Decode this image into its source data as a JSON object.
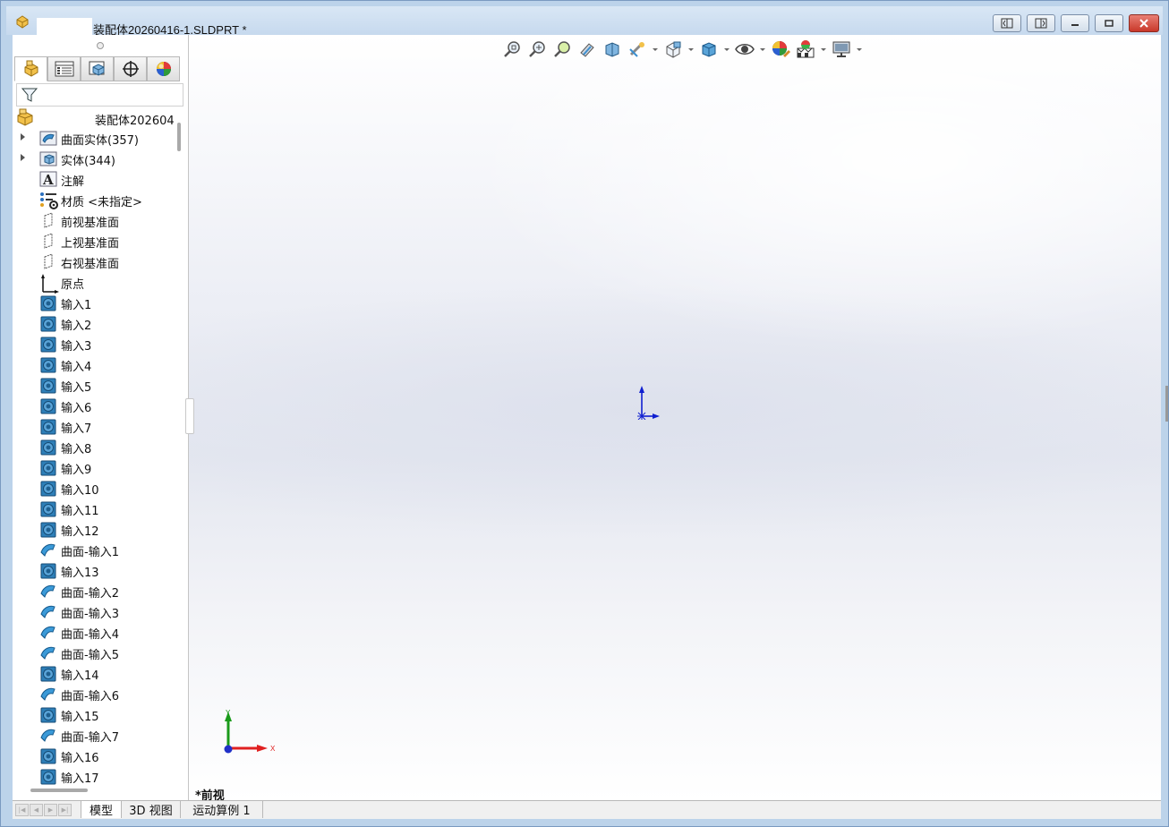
{
  "window": {
    "title": "装配体20260416-1.SLDPRT *",
    "buttons": [
      "tile-left",
      "tile-right",
      "minimize",
      "restore",
      "close"
    ]
  },
  "panel": {
    "tabs": [
      {
        "name": "featuremanager",
        "icon": "assembly-tree-icon"
      },
      {
        "name": "propertymanager",
        "icon": "property-list-icon"
      },
      {
        "name": "configurationmanager",
        "icon": "configuration-icon"
      },
      {
        "name": "dimxpert",
        "icon": "crosshair-icon"
      },
      {
        "name": "display-manager",
        "icon": "appearance-ball-icon"
      }
    ],
    "root_label": "装配体202604",
    "tree": [
      {
        "label": "曲面实体(357)",
        "icon": "surface-bodies-folder-icon",
        "expandable": true
      },
      {
        "label": "实体(344)",
        "icon": "solid-bodies-folder-icon",
        "expandable": true
      },
      {
        "label": "注解",
        "icon": "annotations-icon",
        "expandable": false
      },
      {
        "label": "材质 <未指定>",
        "icon": "material-icon",
        "expandable": false
      },
      {
        "label": "前视基准面",
        "icon": "plane-icon",
        "expandable": false
      },
      {
        "label": "上视基准面",
        "icon": "plane-icon",
        "expandable": false
      },
      {
        "label": "右视基准面",
        "icon": "plane-icon",
        "expandable": false
      },
      {
        "label": "原点",
        "icon": "origin-icon",
        "expandable": false
      },
      {
        "label": "输入1",
        "icon": "imported-body-icon",
        "expandable": false
      },
      {
        "label": "输入2",
        "icon": "imported-body-icon",
        "expandable": false
      },
      {
        "label": "输入3",
        "icon": "imported-body-icon",
        "expandable": false
      },
      {
        "label": "输入4",
        "icon": "imported-body-icon",
        "expandable": false
      },
      {
        "label": "输入5",
        "icon": "imported-body-icon",
        "expandable": false
      },
      {
        "label": "输入6",
        "icon": "imported-body-icon",
        "expandable": false
      },
      {
        "label": "输入7",
        "icon": "imported-body-icon",
        "expandable": false
      },
      {
        "label": "输入8",
        "icon": "imported-body-icon",
        "expandable": false
      },
      {
        "label": "输入9",
        "icon": "imported-body-icon",
        "expandable": false
      },
      {
        "label": "输入10",
        "icon": "imported-body-icon",
        "expandable": false
      },
      {
        "label": "输入11",
        "icon": "imported-body-icon",
        "expandable": false
      },
      {
        "label": "输入12",
        "icon": "imported-body-icon",
        "expandable": false
      },
      {
        "label": "曲面-输入1",
        "icon": "imported-surface-icon",
        "expandable": false
      },
      {
        "label": "输入13",
        "icon": "imported-body-icon",
        "expandable": false
      },
      {
        "label": "曲面-输入2",
        "icon": "imported-surface-icon",
        "expandable": false
      },
      {
        "label": "曲面-输入3",
        "icon": "imported-surface-icon",
        "expandable": false
      },
      {
        "label": "曲面-输入4",
        "icon": "imported-surface-icon",
        "expandable": false
      },
      {
        "label": "曲面-输入5",
        "icon": "imported-surface-icon",
        "expandable": false
      },
      {
        "label": "输入14",
        "icon": "imported-body-icon",
        "expandable": false
      },
      {
        "label": "曲面-输入6",
        "icon": "imported-surface-icon",
        "expandable": false
      },
      {
        "label": "输入15",
        "icon": "imported-body-icon",
        "expandable": false
      },
      {
        "label": "曲面-输入7",
        "icon": "imported-surface-icon",
        "expandable": false
      },
      {
        "label": "输入16",
        "icon": "imported-body-icon",
        "expandable": false
      },
      {
        "label": "输入17",
        "icon": "imported-body-icon",
        "expandable": false
      }
    ]
  },
  "hud_toolbar": [
    "zoom-to-fit-icon",
    "zoom-to-area-icon",
    "previous-view-icon",
    "section-view-icon",
    "dynamic-annotation-view-icon",
    "view-sketch-icon",
    "view-orientation-icon",
    "display-style-icon",
    "hide-show-items-icon",
    "edit-appearance-icon",
    "apply-scene-icon",
    "view-settings-icon"
  ],
  "viewport": {
    "view_name": "*前视",
    "triad": {
      "x": "X",
      "y": "Y"
    }
  },
  "bottom_tabs": [
    {
      "label": "模型",
      "active": true
    },
    {
      "label": "3D 视图",
      "active": false
    },
    {
      "label": "运动算例 1",
      "active": false
    }
  ],
  "colors": {
    "triad_x": "#e02020",
    "triad_y": "#1a9a1a",
    "triad_z": "#2030c8",
    "origin": "#1020d0",
    "body_icon": "#2e7fb8"
  }
}
